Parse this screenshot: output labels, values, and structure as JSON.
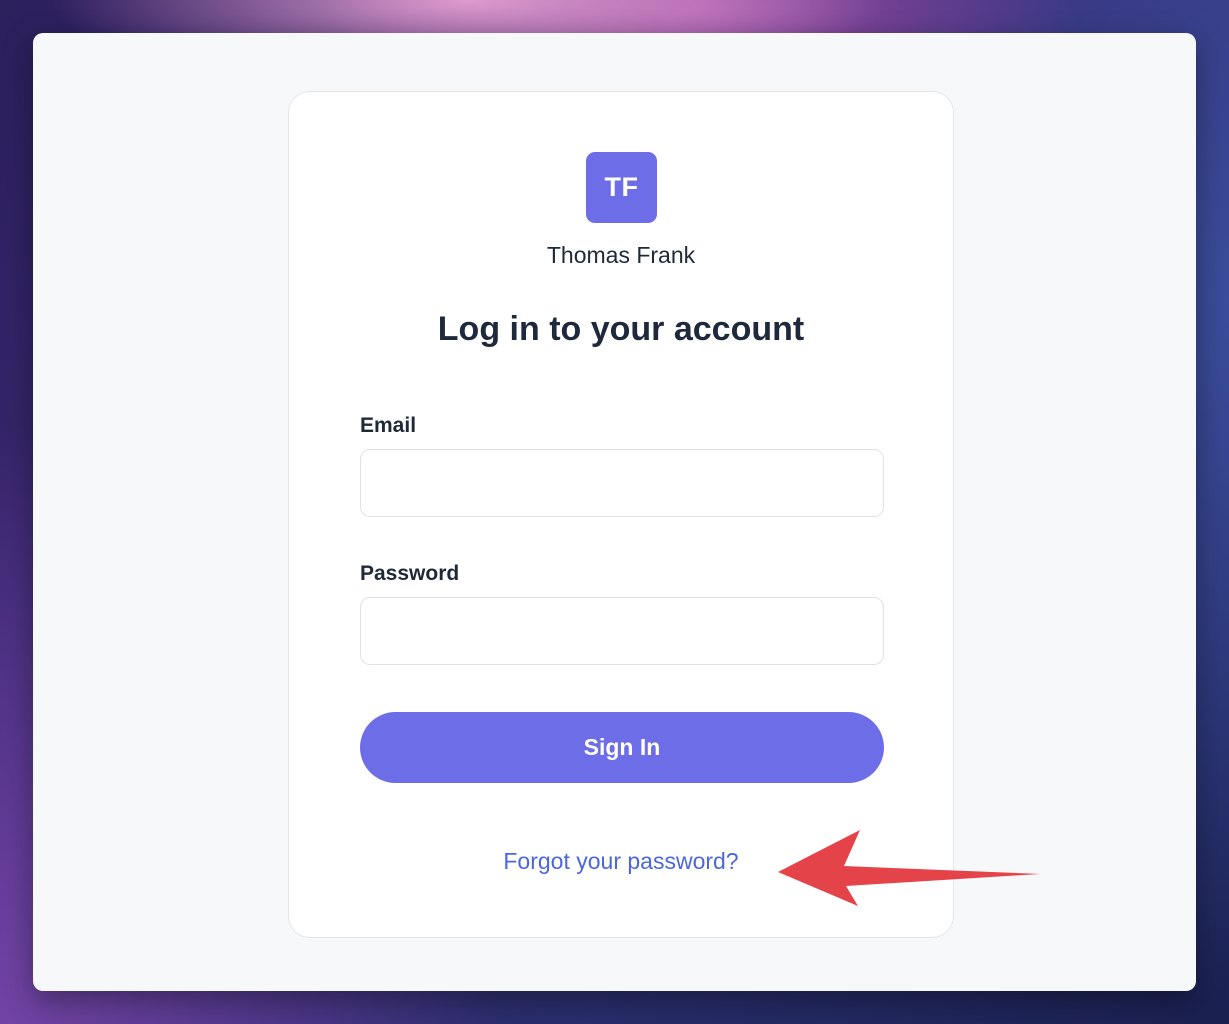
{
  "org": {
    "initials": "TF",
    "name": "Thomas Frank"
  },
  "login": {
    "heading": "Log in to your account",
    "email_label": "Email",
    "email_value": "",
    "password_label": "Password",
    "password_value": "",
    "submit_label": "Sign In",
    "forgot_link": "Forgot your password?"
  },
  "colors": {
    "accent": "#6e6de8",
    "link": "#4a67e0",
    "annotation_arrow": "#e5434a"
  },
  "annotation": {
    "icon": "arrow-left-icon"
  }
}
